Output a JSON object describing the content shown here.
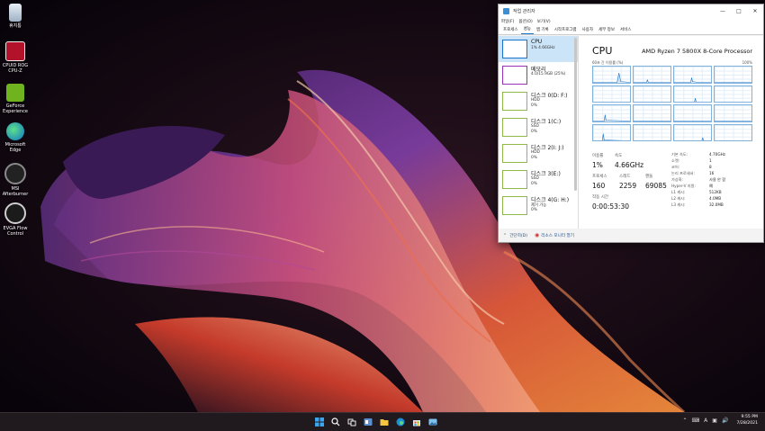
{
  "desktop": {
    "icons": [
      {
        "label": "휴지통"
      },
      {
        "label": "CPUID ROG\nCPU-Z"
      },
      {
        "label": "GeForce\nExperience"
      },
      {
        "label": "Microsoft\nEdge"
      },
      {
        "label": "MSI\nAfterburner"
      },
      {
        "label": "EVGA Flow\nControl"
      }
    ]
  },
  "taskmgr": {
    "title": "작업 관리자",
    "menu": [
      "파일(F)",
      "옵션(O)",
      "보기(V)"
    ],
    "tabs": [
      "프로세스",
      "성능",
      "앱 기록",
      "시작프로그램",
      "사용자",
      "세부 정보",
      "서비스"
    ],
    "active_tab": "성능",
    "perf_items": [
      {
        "name": "CPU",
        "sub1": "1% 4.66GHz",
        "sub2": ""
      },
      {
        "name": "메모리",
        "sub1": "4.0/15.9GB (25%)",
        "sub2": ""
      },
      {
        "name": "디스크 0(D: F:)",
        "sub1": "HDD",
        "sub2": "0%"
      },
      {
        "name": "디스크 1(C:)",
        "sub1": "SSD",
        "sub2": "0%"
      },
      {
        "name": "디스크 2(I: J:)",
        "sub1": "HDD",
        "sub2": "0%"
      },
      {
        "name": "디스크 3(E:)",
        "sub1": "SSD",
        "sub2": "0%"
      },
      {
        "name": "디스크 4(G: H:)",
        "sub1": "제거 가능",
        "sub2": "0%"
      }
    ],
    "cpu": {
      "title": "CPU",
      "model": "AMD Ryzen 7 5800X 8-Core Processor",
      "graph_caption": "60초 간 이용률 (%)",
      "graph_max": "100%",
      "stats": {
        "util_label": "이용률",
        "util": "1%",
        "speed_label": "속도",
        "speed": "4.66GHz",
        "proc_label": "프로세스",
        "proc": "160",
        "threads_label": "스레드",
        "threads": "2259",
        "handles_label": "핸들",
        "handles": "69085",
        "uptime_label": "작동 시간",
        "uptime": "0:00:53:30"
      },
      "info": [
        {
          "k": "기본 속도:",
          "v": "4.70GHz"
        },
        {
          "k": "소켓:",
          "v": "1"
        },
        {
          "k": "코어:",
          "v": "8"
        },
        {
          "k": "논리 프로세서:",
          "v": "16"
        },
        {
          "k": "가상화:",
          "v": "사용 안 함"
        },
        {
          "k": "Hyper-V 지원:",
          "v": "예"
        },
        {
          "k": "L1 캐시:",
          "v": "512KB"
        },
        {
          "k": "L2 캐시:",
          "v": "4.0MB"
        },
        {
          "k": "L3 캐시:",
          "v": "32.0MB"
        }
      ]
    },
    "footer": {
      "collapse": "간단히(D)",
      "monitor": "리소스 모니터 열기"
    }
  },
  "taskbar": {
    "buttons": [
      "windows-start",
      "search",
      "task-view",
      "widgets",
      "file-explorer",
      "edge",
      "store",
      "photos"
    ],
    "clock_time": "9:55 PM",
    "clock_date": "7/28/2021"
  },
  "colors": {
    "accent": "#1a73c9",
    "memory": "#9932b8",
    "disk": "#8fb84a",
    "taskbar": "#201a1e"
  }
}
